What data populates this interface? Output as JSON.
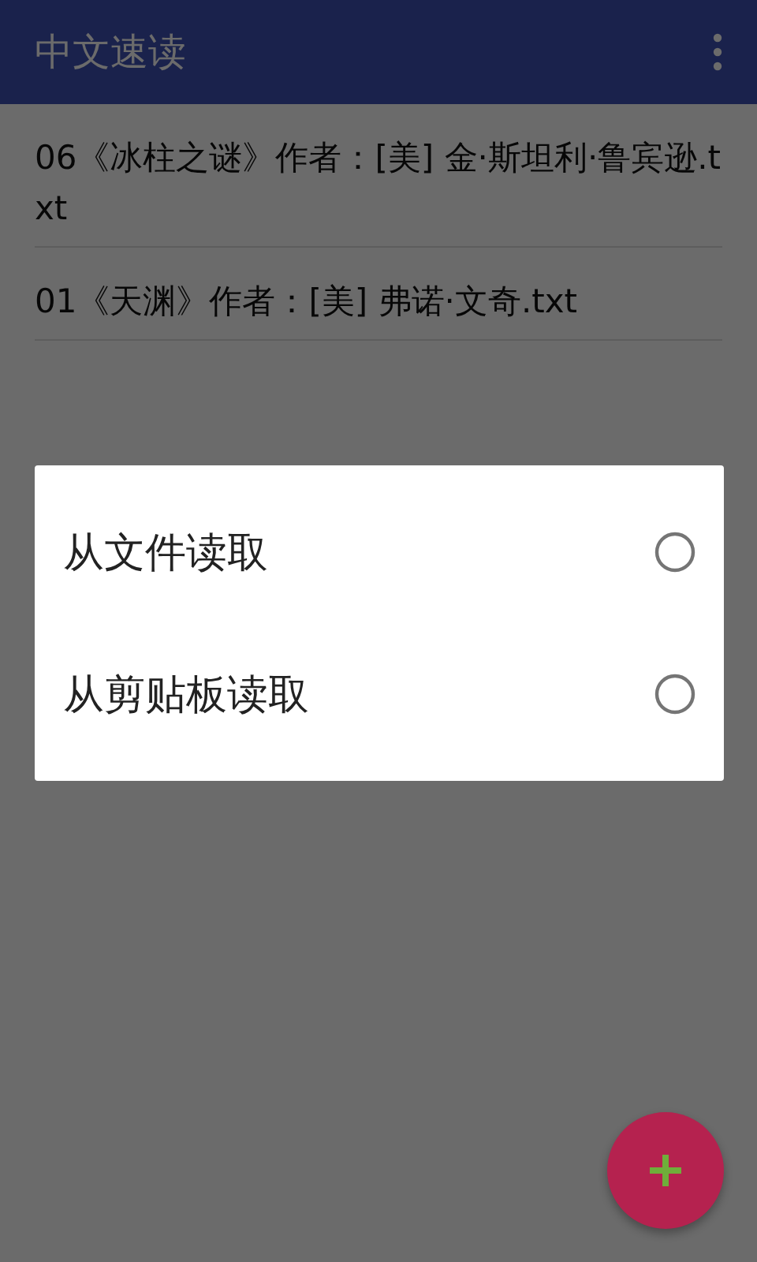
{
  "app_bar": {
    "title": "中文速读"
  },
  "files": [
    {
      "name": "06《冰柱之谜》作者：[美] 金·斯坦利·鲁宾逊.txt"
    },
    {
      "name": "01《天渊》作者：[美] 弗诺·文奇.txt"
    }
  ],
  "dialog": {
    "options": [
      {
        "label": "从文件读取",
        "selected": false
      },
      {
        "label": "从剪贴板读取",
        "selected": false
      }
    ]
  }
}
